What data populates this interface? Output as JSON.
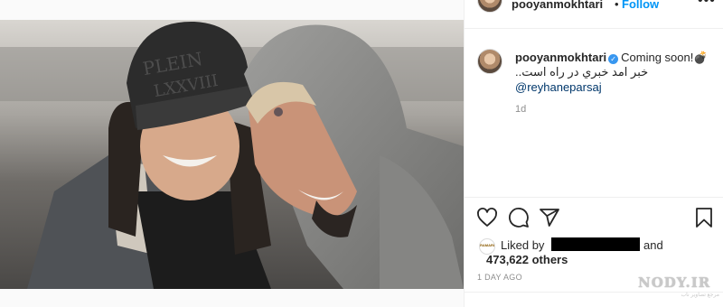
{
  "post": {
    "username": "pooyanmokhtari",
    "follow_separator": "•",
    "follow_label": "Follow",
    "more_label": "•••"
  },
  "caption": {
    "username": "pooyanmokhtari",
    "text": "Coming soon!💣",
    "line2": "خبر امد خبري در راه است..",
    "mention": "@reyhaneparsaj",
    "time": "1d"
  },
  "likes": {
    "liked_by": "Liked by",
    "and": "and",
    "others": "473,622 others",
    "mini_avatar_text": "RAMARDI"
  },
  "timestamp": "1 DAY AGO",
  "watermark": {
    "logo": "NODY.IR",
    "tagline": "مرجع تصاویر ناب"
  },
  "colors": {
    "link": "#0095f6",
    "verified": "#3897f0",
    "mention": "#00376b",
    "muted": "#8e8e8e"
  },
  "icons": [
    "heart-icon",
    "comment-icon",
    "share-icon",
    "bookmark-icon",
    "verified-icon",
    "more-icon"
  ]
}
